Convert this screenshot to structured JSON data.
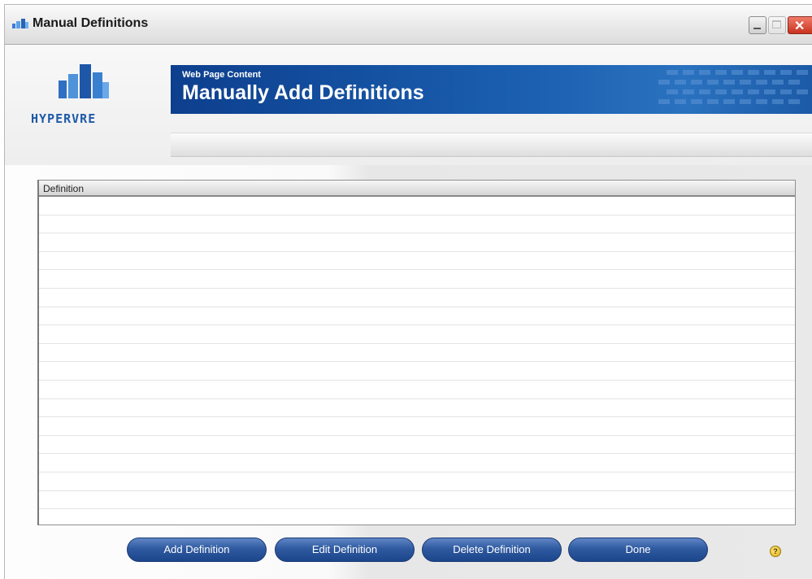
{
  "window": {
    "title": "Manual Definitions"
  },
  "logo": {
    "text": "HYPERVRE"
  },
  "banner": {
    "subtitle": "Web Page Content",
    "title": "Manually Add Definitions"
  },
  "definitions_list": {
    "column_header": "Definition",
    "rows": []
  },
  "actions": {
    "add_label": "Add Definition",
    "edit_label": "Edit Definition",
    "delete_label": "Delete Definition",
    "done_label": "Done"
  },
  "help": {
    "symbol": "?"
  },
  "colors": {
    "banner": "#1b5fb0",
    "button": "#2f5aa0",
    "logo": "#1e5aa8"
  }
}
